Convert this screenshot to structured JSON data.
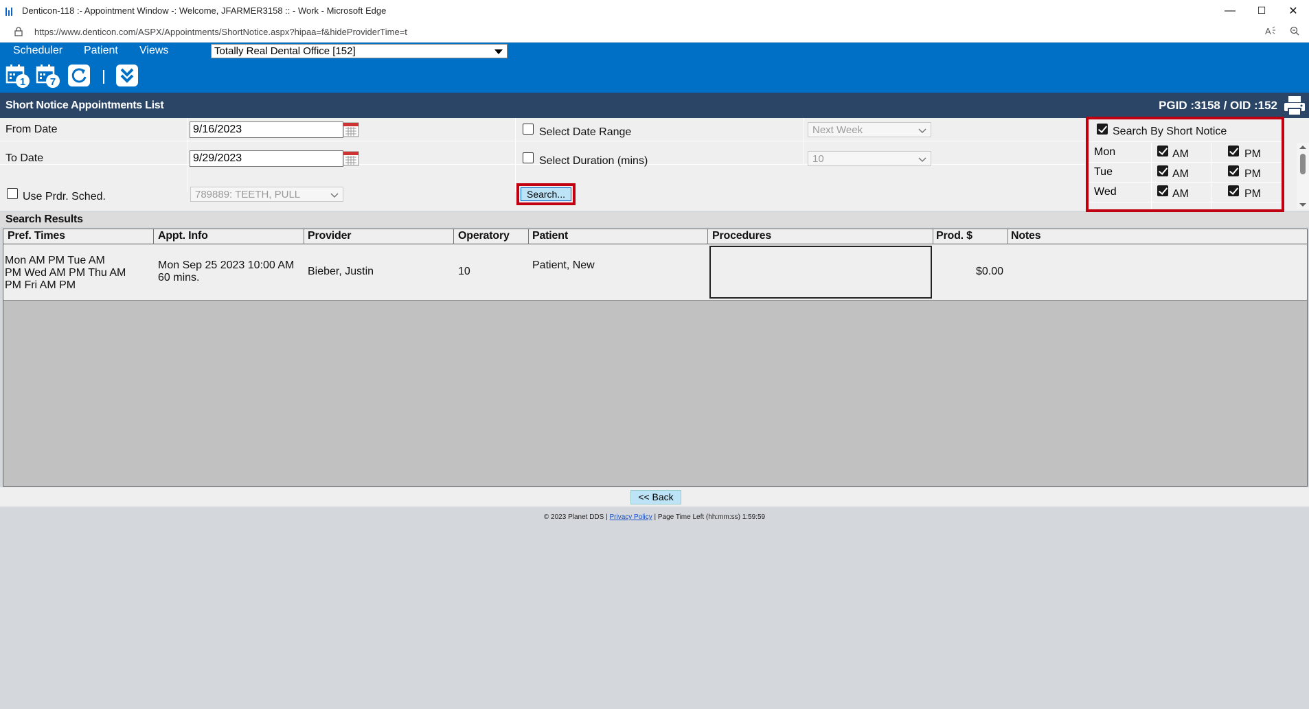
{
  "browser": {
    "window_title": "Denticon-118 :- Appointment Window -: Welcome, JFARMER3158 :: - Work - Microsoft Edge",
    "url": "https://www.denticon.com/ASPX/Appointments/ShortNotice.aspx?hipaa=f&hideProviderTime=t",
    "minimize": "—",
    "maximize": "☐",
    "close": "✕"
  },
  "nav": {
    "menu": [
      "Scheduler",
      "Patient",
      "Views"
    ],
    "office": "Totally Real Dental Office [152]"
  },
  "header": {
    "title": "Short Notice Appointments List",
    "ids": "PGID :3158  /  OID :152"
  },
  "form": {
    "from_date_label": "From Date",
    "from_date": "9/16/2023",
    "to_date_label": "To Date",
    "to_date": "9/29/2023",
    "use_prdr_label": "Use Prdr. Sched.",
    "use_prdr_checked": false,
    "provider_select": "789889: TEETH, PULL",
    "select_date_range_label": "Select Date Range",
    "select_date_range_checked": false,
    "date_range_select": "Next Week",
    "select_duration_label": "Select Duration (mins)",
    "select_duration_checked": false,
    "duration_select": "10",
    "search_button": "Search..."
  },
  "short_notice": {
    "label": "Search By Short Notice",
    "checked": true,
    "days": [
      {
        "day": "Mon",
        "am": "AM",
        "pm": "PM",
        "am_checked": true,
        "pm_checked": true
      },
      {
        "day": "Tue",
        "am": "AM",
        "pm": "PM",
        "am_checked": true,
        "pm_checked": true
      },
      {
        "day": "Wed",
        "am": "AM",
        "pm": "PM",
        "am_checked": true,
        "pm_checked": true
      }
    ]
  },
  "results": {
    "title": "Search Results",
    "columns": [
      "Pref. Times",
      "Appt. Info",
      "Provider",
      "Operatory",
      "Patient",
      "Procedures",
      "Prod. $",
      "Notes"
    ],
    "rows": [
      {
        "pref_times_1": " Mon AM PM Tue AM",
        "pref_times_2": "PM Wed AM PM Thu AM",
        "pref_times_3": "PM Fri AM PM",
        "appt_info_1": "Mon Sep 25 2023 10:00 AM",
        "appt_info_2": "60 mins.",
        "provider": "Bieber, Justin",
        "operatory": "10",
        "patient": "Patient, New",
        "procedures": "",
        "prod": "$0.00",
        "notes": ""
      }
    ]
  },
  "back_button": "<< Back",
  "footer": {
    "copyright": "© 2023 Planet DDS | ",
    "privacy": "Privacy Policy",
    "time_left": " |  Page Time Left (hh:mm:ss) 1:59:59"
  },
  "colors": {
    "nav_blue": "#0070c7",
    "header_navy": "#2a4566",
    "highlight_red": "#c00010"
  }
}
